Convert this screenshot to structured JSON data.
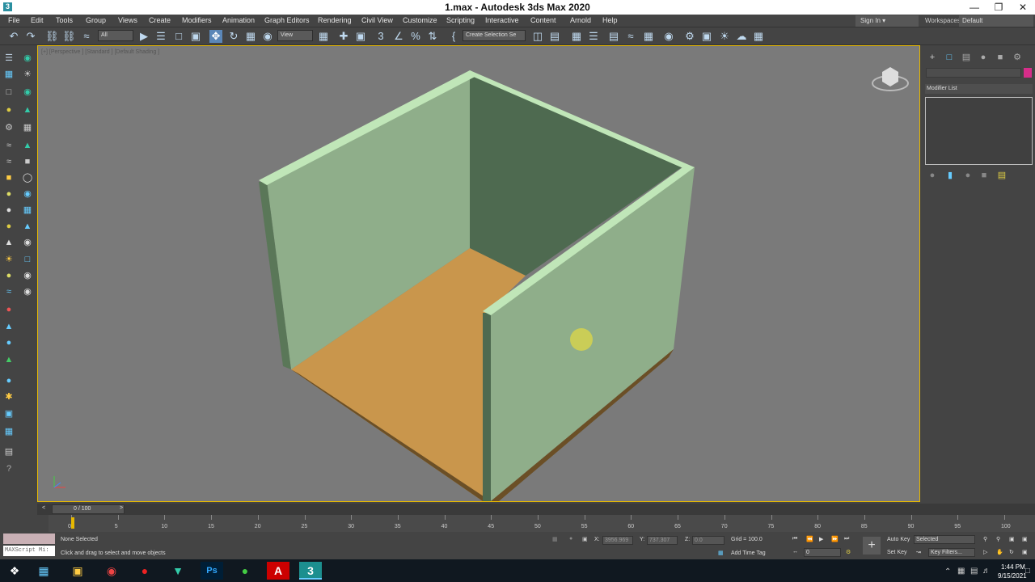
{
  "window": {
    "title": "1.max - Autodesk 3ds Max 2020"
  },
  "menu": [
    "File",
    "Edit",
    "Tools",
    "Group",
    "Views",
    "Create",
    "Modifiers",
    "Animation",
    "Graph Editors",
    "Rendering",
    "Civil View",
    "Customize",
    "Scripting",
    "Interactive",
    "Content",
    "Arnold",
    "Help"
  ],
  "account": {
    "signin": "Sign In",
    "workspaces_label": "Workspaces:",
    "workspace": "Default"
  },
  "toolbar": {
    "filter": "All",
    "ref_coord": "View",
    "selection_set": "Create Selection Se"
  },
  "viewport": {
    "label": "[+] [Perspective ] [Standard ] [Default Shading ]"
  },
  "colors": {
    "wall_light": "#8fae8a",
    "wall_dark": "#4e6a50",
    "wall_top": "#c0e6b8",
    "floor": "#c9964c",
    "selection_border": "#e6b800",
    "object_color": "#d62d8a"
  },
  "command_panel": {
    "modifier_list": "Modifier List"
  },
  "timeline": {
    "frame": "0 / 100",
    "ticks": [
      "0",
      "5",
      "10",
      "15",
      "20",
      "25",
      "30",
      "35",
      "40",
      "45",
      "50",
      "55",
      "60",
      "65",
      "70",
      "75",
      "80",
      "85",
      "90",
      "95",
      "100"
    ]
  },
  "status": {
    "maxscript": "MAXScript Mi:",
    "selected": "None Selected",
    "prompt": "Click and drag to select and move objects",
    "x_label": "X:",
    "x_value": "3956.969",
    "y_label": "Y:",
    "y_value": "737.307",
    "z_label": "Z:",
    "z_value": "0.0",
    "grid": "Grid = 100.0",
    "add_time_tag": "Add Time Tag",
    "auto_key": "Auto Key",
    "set_key": "Set Key",
    "selected_dropdown": "Selected",
    "key_filters": "Key Filters...",
    "frame_field": "0"
  },
  "clock": {
    "time": "1:44 PM",
    "date": "9/15/2021"
  }
}
